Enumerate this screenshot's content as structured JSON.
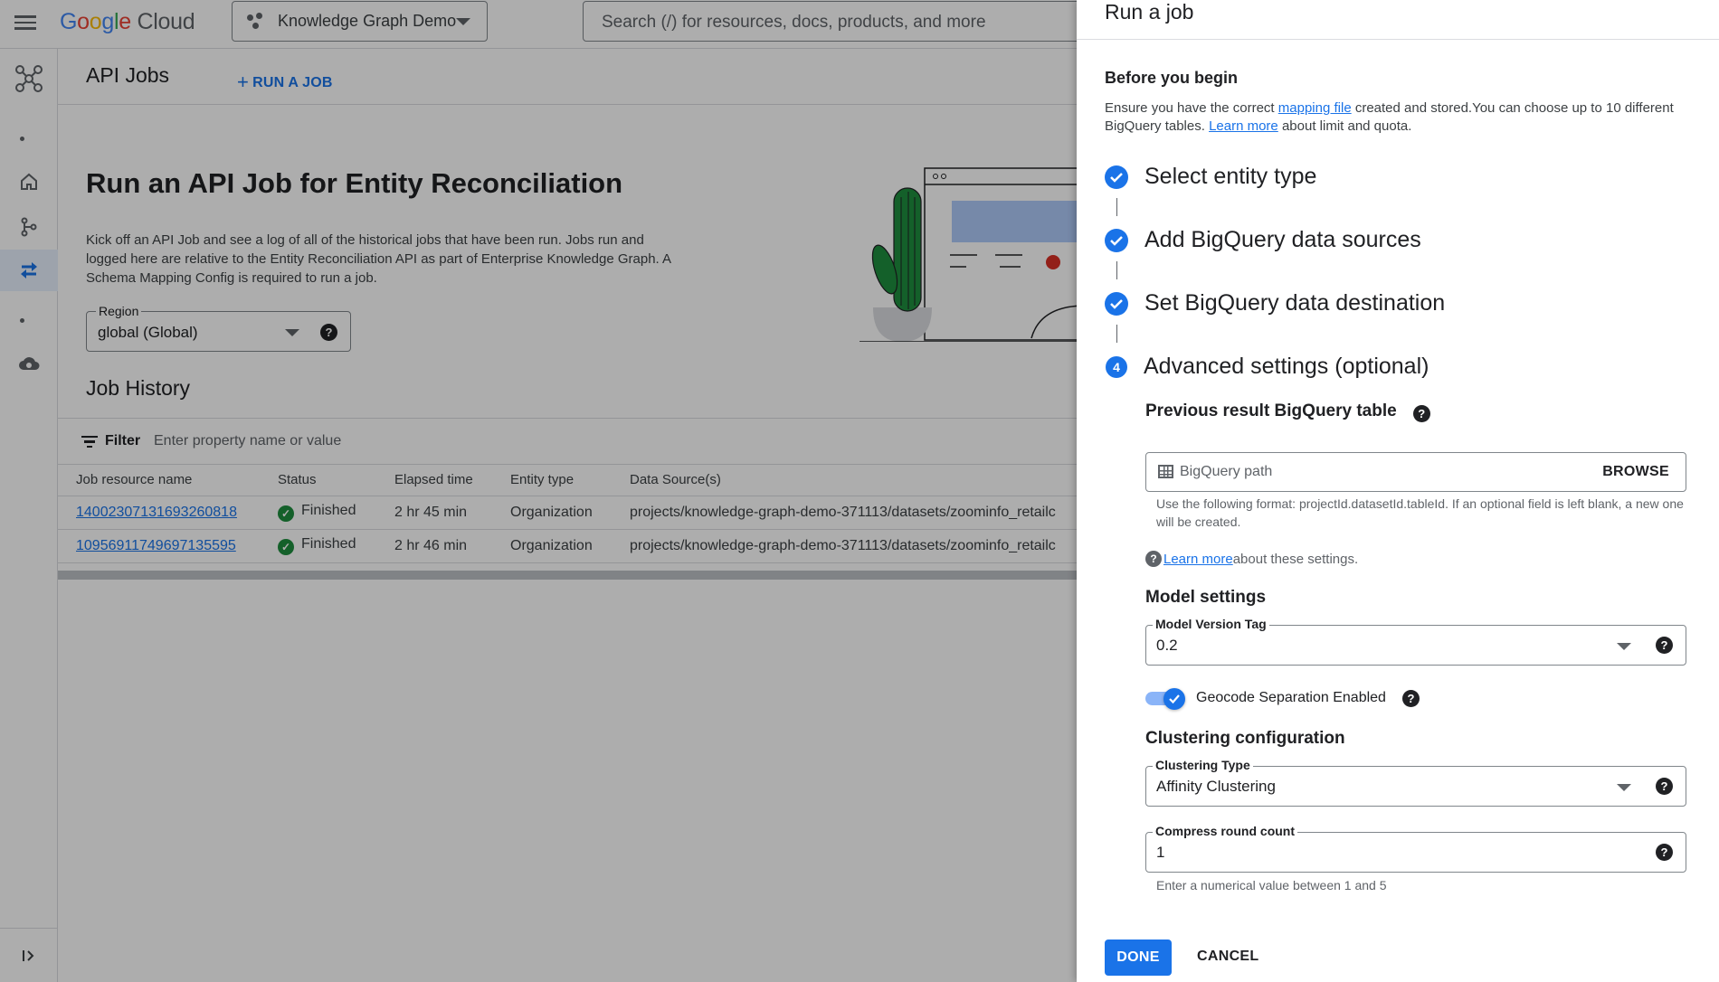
{
  "header": {
    "logo_google": "Google",
    "logo_cloud": "Cloud",
    "project_name": "Knowledge Graph Demo",
    "search_placeholder": "Search (/) for resources, docs, products, and more"
  },
  "page": {
    "title": "API Jobs",
    "run_job_link": "RUN A JOB",
    "hero_title": "Run an API Job for Entity Reconciliation",
    "hero_desc": "Kick off an API Job and see a log of all of the historical jobs that have been run. Jobs run and logged here are relative to the Entity Reconciliation API as part of Enterprise Knowledge Graph. A Schema Mapping Config is required to run a job.",
    "region": {
      "label": "Region",
      "value": "global (Global)"
    },
    "job_history_title": "Job History",
    "filter": {
      "label": "Filter",
      "placeholder": "Enter property name or value"
    },
    "table": {
      "columns": [
        "Job resource name",
        "Status",
        "Elapsed time",
        "Entity type",
        "Data Source(s)"
      ],
      "rows": [
        {
          "name": "14002307131693260818",
          "status": "Finished",
          "elapsed": "2 hr 45 min",
          "entity": "Organization",
          "source": "projects/knowledge-graph-demo-371113/datasets/zoominfo_retailc"
        },
        {
          "name": "10956911749697135595",
          "status": "Finished",
          "elapsed": "2 hr 46 min",
          "entity": "Organization",
          "source": "projects/knowledge-graph-demo-371113/datasets/zoominfo_retailc"
        }
      ]
    }
  },
  "panel": {
    "title": "Run a job",
    "before_title": "Before you begin",
    "before_text_1": "Ensure you have the correct ",
    "before_link_1": "mapping file",
    "before_text_2": " created and stored.You can choose up to 10 different BigQuery tables. ",
    "before_link_2": "Learn more",
    "before_text_3": " about limit and quota.",
    "steps": [
      {
        "label": "Select entity type",
        "state": "complete"
      },
      {
        "label": "Add BigQuery data sources",
        "state": "complete"
      },
      {
        "label": "Set BigQuery data destination",
        "state": "complete"
      },
      {
        "label": "Advanced settings (optional)",
        "state": "current",
        "number": "4"
      }
    ],
    "previous_result": {
      "title": "Previous result BigQuery table",
      "placeholder": "BigQuery path",
      "browse": "BROWSE",
      "hint": "Use the following format: projectId.datasetId.tableId. If an optional field is left blank, a new one will be created."
    },
    "learn_more_link": "Learn more",
    "learn_more_text": " about these settings.",
    "model_settings": {
      "title": "Model settings",
      "version_label": "Model Version Tag",
      "version_value": "0.2",
      "geocode_label": "Geocode Separation Enabled",
      "geocode_enabled": true
    },
    "clustering": {
      "title": "Clustering configuration",
      "type_label": "Clustering Type",
      "type_value": "Affinity Clustering",
      "round_label": "Compress round count",
      "round_value": "1",
      "round_hint": "Enter a numerical value between 1 and 5"
    },
    "done_label": "DONE",
    "cancel_label": "CANCEL"
  },
  "colors": {
    "accent": "#1a73e8",
    "success": "#1e8e3e",
    "toggle_track": "#8ab4f8"
  }
}
